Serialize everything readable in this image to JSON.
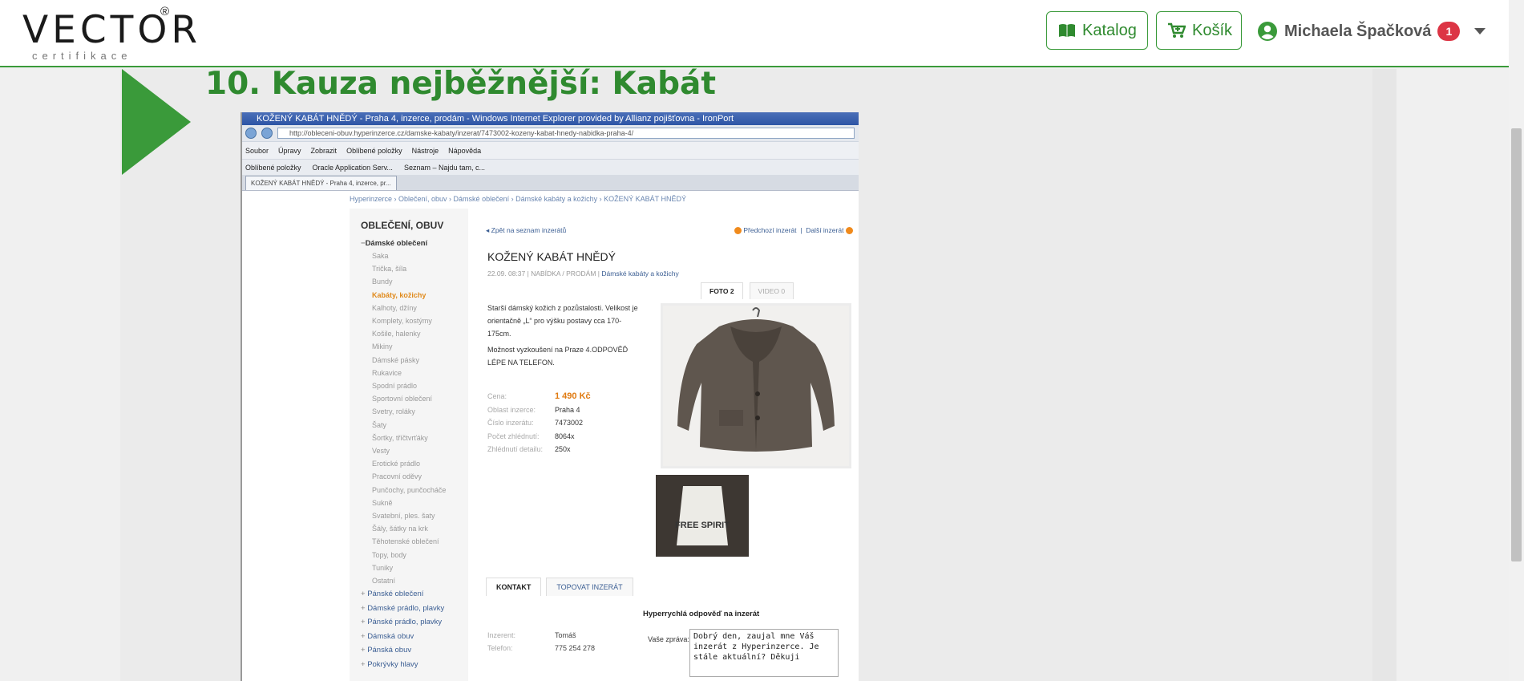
{
  "brand": {
    "logo_text": "VECTOR",
    "logo_reg": "®",
    "logo_sub": "certifikace"
  },
  "nav": {
    "katalog_label": "Katalog",
    "kosik_label": "Košík",
    "user_name": "Michaela Špačková",
    "notification_count": "1"
  },
  "slide": {
    "title": "10. Kauza nejběžnější: Kabát"
  },
  "screenshot": {
    "window_title": "KOŽENÝ KABÁT HNĚDÝ - Praha 4, inzerce, prodám - Windows Internet Explorer provided by Allianz pojišťovna - IronPort",
    "address_url": "http://obleceni-obuv.hyperinzerce.cz/damske-kabaty/inzerat/7473002-kozeny-kabat-hnedy-nabidka-praha-4/",
    "menu": [
      "Soubor",
      "Úpravy",
      "Zobrazit",
      "Oblíbené položky",
      "Nástroje",
      "Nápověda"
    ],
    "favorites": [
      "Oblíbené položky",
      "Oracle Application Serv...",
      "Seznam – Najdu tam, c..."
    ],
    "tab_label": "KOŽENÝ KABÁT HNĚDÝ - Praha 4, inzerce, pr...",
    "breadcrumb": "Hyperinzerce › Oblečení, obuv › Dámské oblečení › Dámské kabáty a kožichy › KOŽENÝ KABÁT HNĚDÝ",
    "sidebar": {
      "heading": "OBLEČENÍ, OBUV",
      "category": "Dámské oblečení",
      "items": [
        "Saka",
        "Trička, šíla",
        "Bundy",
        "Kabáty, kožichy",
        "Kalhoty, džíny",
        "Komplety, kostýmy",
        "Košile, halenky",
        "Mikiny",
        "Dámské pásky",
        "Rukavice",
        "Spodní prádlo",
        "Sportovní oblečení",
        "Svetry, roláky",
        "Šaty",
        "Šortky, tříčtvrťáky",
        "Vesty",
        "Erotické prádlo",
        "Pracovní oděvy",
        "Punčochy, punčocháče",
        "Sukně",
        "Svatební, ples. šaty",
        "Šály, šátky na krk",
        "Těhotenské oblečení",
        "Topy, body",
        "Tuniky",
        "Ostatní"
      ],
      "active_item": "Kabáty, kožichy",
      "subcategories": [
        "Pánské oblečení",
        "Dámské prádlo, plavky",
        "Pánské prádlo, plavky",
        "Dámská obuv",
        "Pánská obuv",
        "Pokrývky hlavy"
      ]
    },
    "ad": {
      "back_link": "Zpět na seznam inzerátů",
      "prev": "Předchozí inzerát",
      "next": "Další inzerát",
      "title": "KOŽENÝ KABÁT HNĚDÝ",
      "meta_prefix": "22.09. 08:37 | NABÍDKA / PRODÁM |",
      "meta_category": "Dámské kabáty a kožichy",
      "photo_tab": "FOTO 2",
      "video_tab": "VIDEO 0",
      "desc_1": "Starší dámský kožich z pozůstalosti. Velikost je orientačně „L“ pro výšku postavy cca 170-175cm.",
      "desc_2": "Možnost vyzkoušení na Praze 4.ODPOVĚĎ LÉPE NA TELEFON.",
      "params": [
        {
          "label": "Cena:",
          "value": "1 490 Kč"
        },
        {
          "label": "Oblast inzerce:",
          "value": "Praha 4"
        },
        {
          "label": "Číslo inzerátu:",
          "value": "7473002"
        },
        {
          "label": "Počet zhlédnutí:",
          "value": "8064x"
        },
        {
          "label": "Zhlédnutí detailu:",
          "value": "250x"
        }
      ],
      "label_text": "FREE SPIRIT",
      "tab_contact": "KONTAKT",
      "tab_top": "TOPOVAT INZERÁT",
      "contact": [
        {
          "label": "Inzerent:",
          "value": "Tomáš"
        },
        {
          "label": "Telefon:",
          "value": "775 254 278"
        }
      ],
      "quick_heading": "Hyperrychlá odpověď na inzerát",
      "quick_label": "Vaše zpráva:",
      "quick_message": "Dobrý den, zaujal mne Váš inzerát z Hyperinzerce. Je stále aktuální? Děkuji"
    }
  },
  "colors": {
    "accent": "#3a9a3a",
    "badge": "#dc3545",
    "price": "#e07a10"
  }
}
